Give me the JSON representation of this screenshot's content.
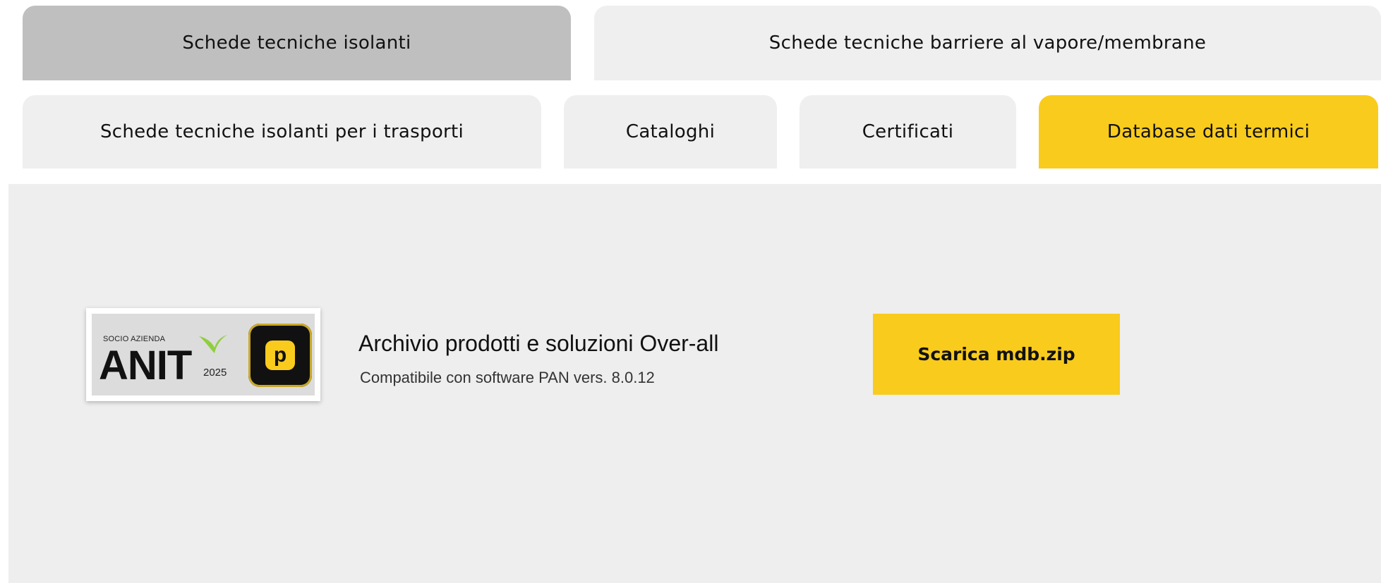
{
  "tabs": {
    "row1": [
      {
        "label": "Schede tecniche isolanti"
      },
      {
        "label": "Schede tecniche barriere al vapore/membrane"
      }
    ],
    "row2": [
      {
        "label": "Schede tecniche isolanti per i trasporti"
      },
      {
        "label": "Cataloghi"
      },
      {
        "label": "Certificati"
      },
      {
        "label": "Database dati termici"
      }
    ]
  },
  "badge": {
    "socio": "SOCIO AZIENDA",
    "brand": "ANIT",
    "year": "2025",
    "app_letter": "p"
  },
  "content": {
    "title": "Archivio prodotti e soluzioni Over-all",
    "subtitle": "Compatibile con software PAN vers. 8.0.12",
    "download_label": "Scarica mdb.zip"
  },
  "colors": {
    "accent_yellow": "#f9cb1c",
    "active_gray": "#bfbfbf",
    "tab_bg": "#efefef",
    "panel_bg": "#eeeeee"
  }
}
